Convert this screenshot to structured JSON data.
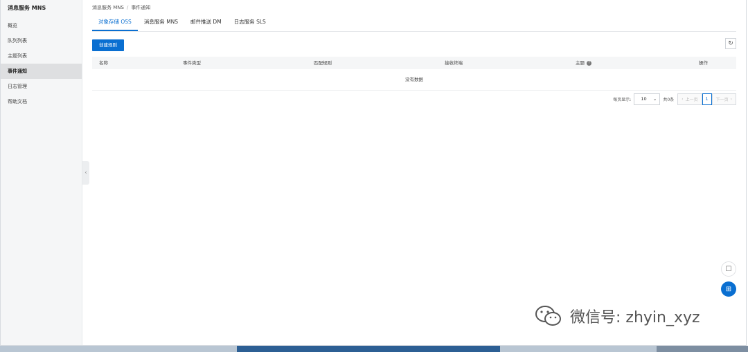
{
  "sidebar": {
    "title": "消息服务 MNS",
    "items": [
      {
        "label": "概览"
      },
      {
        "label": "队列列表"
      },
      {
        "label": "主题列表"
      },
      {
        "label": "事件通知"
      },
      {
        "label": "日志管理"
      },
      {
        "label": "帮助文档"
      }
    ],
    "active_index": 3
  },
  "breadcrumb": {
    "parent": "消息服务 MNS",
    "separator": "/",
    "current": "事件通知"
  },
  "tabs": [
    {
      "label": "对象存储 OSS"
    },
    {
      "label": "消息服务 MNS"
    },
    {
      "label": "邮件推送 DM"
    },
    {
      "label": "日志服务 SLS"
    }
  ],
  "active_tab": 0,
  "toolbar": {
    "create_rule_label": "创建规则",
    "refresh_icon": "refresh-icon"
  },
  "table": {
    "columns": [
      {
        "label": "名称"
      },
      {
        "label": "事件类型"
      },
      {
        "label": "匹配规则"
      },
      {
        "label": "接收终端"
      },
      {
        "label": "主题"
      },
      {
        "label": "操作"
      }
    ],
    "empty_text": "没有数据"
  },
  "pagination": {
    "page_size_label": "每页显示:",
    "page_size_value": "10",
    "total_label": "共0条",
    "prev_label": "上一页",
    "current_page": "1",
    "next_label": "下一页"
  },
  "watermark": {
    "text": "微信号: zhyin_xyz"
  },
  "colors": {
    "accent": "#0a6fd1",
    "sidebar_bg": "#f5f6f7",
    "sidebar_active_bg": "#dedfe1",
    "table_header_bg": "#f5f6f7"
  }
}
